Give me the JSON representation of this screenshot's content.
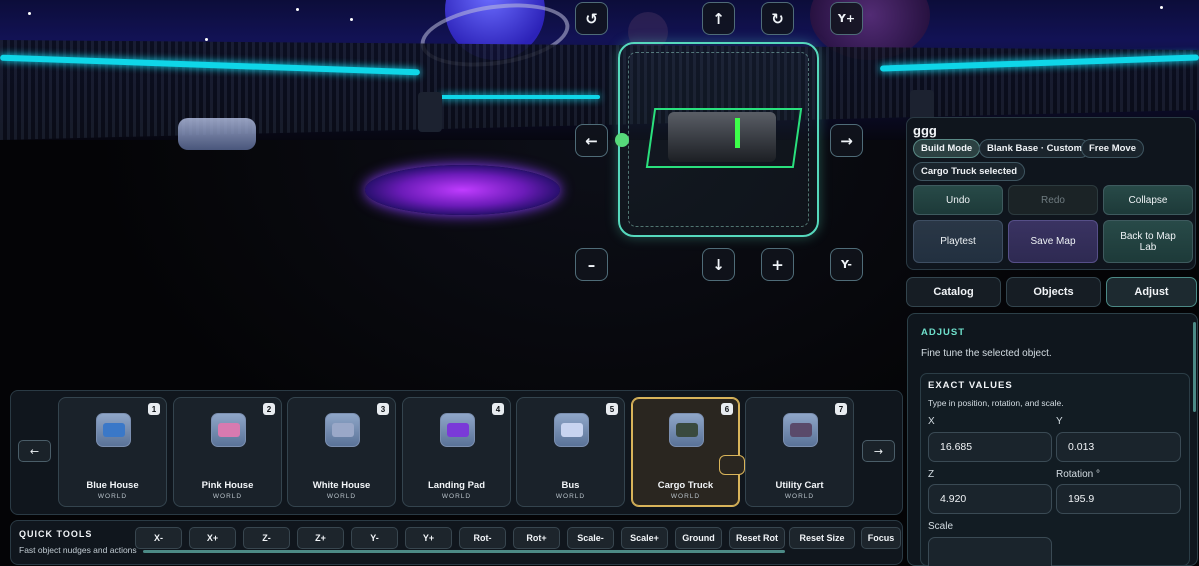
{
  "gizmo": {
    "rotate_left": "↺",
    "up": "↑",
    "rotate_right": "↻",
    "y_plus": "Y+",
    "left": "←",
    "right": "→",
    "minus": "–",
    "down": "↓",
    "plus": "+",
    "y_minus": "Y-"
  },
  "panel": {
    "map_name": "ggg",
    "chips": [
      "Build Mode",
      "Blank Base · Custom",
      "Free Move",
      "Cargo Truck selected"
    ],
    "buttons": {
      "undo": "Undo",
      "redo": "Redo",
      "collapse": "Collapse",
      "playtest": "Playtest",
      "save_map": "Save Map",
      "back": "Back to Map Lab"
    },
    "tabs": [
      "Catalog",
      "Objects",
      "Adjust"
    ],
    "active_tab": "Adjust"
  },
  "adjust": {
    "title": "ADJUST",
    "subtitle": "Fine tune the selected object.",
    "exact_values": {
      "title": "EXACT VALUES",
      "subtitle": "Type in position, rotation, and scale.",
      "x_label": "X",
      "x_value": "16.685",
      "y_label": "Y",
      "y_value": "0.013",
      "z_label": "Z",
      "z_value": "4.920",
      "rotation_label": "Rotation °",
      "rotation_value": "195.9",
      "scale_label": "Scale"
    }
  },
  "hotbar": {
    "prev": "←",
    "next": "→",
    "selected_index": 5,
    "slots": [
      {
        "num": "1",
        "name": "Blue House",
        "type": "WORLD",
        "color": "#3a78c8"
      },
      {
        "num": "2",
        "name": "Pink House",
        "type": "WORLD",
        "color": "#d87ab0"
      },
      {
        "num": "3",
        "name": "White House",
        "type": "WORLD",
        "color": "#9aa8c8"
      },
      {
        "num": "4",
        "name": "Landing Pad",
        "type": "WORLD",
        "color": "#7a3ad8"
      },
      {
        "num": "5",
        "name": "Bus",
        "type": "WORLD",
        "color": "#c8d4f0"
      },
      {
        "num": "6",
        "name": "Cargo Truck",
        "type": "WORLD",
        "color": "#3a4a3e"
      },
      {
        "num": "7",
        "name": "Utility Cart",
        "type": "WORLD",
        "color": "#5a4a6a"
      }
    ]
  },
  "quick_tools": {
    "title": "QUICK TOOLS",
    "subtitle": "Fast object nudges and actions",
    "buttons": [
      "X-",
      "X+",
      "Z-",
      "Z+",
      "Y-",
      "Y+",
      "Rot-",
      "Rot+",
      "Scale-",
      "Scale+",
      "Ground",
      "Reset Rot",
      "Reset Size",
      "Focus"
    ]
  },
  "colors": {
    "accent_teal": "#56d9bd",
    "selected_gold": "#d9b45a",
    "neon_cyan": "#0fd6e8"
  }
}
